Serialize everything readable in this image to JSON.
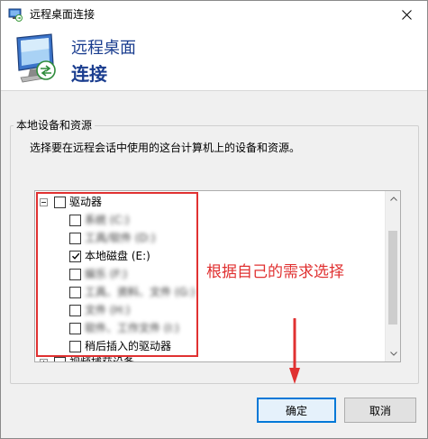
{
  "window": {
    "title": "远程桌面连接",
    "banner_line1": "远程桌面",
    "banner_line2": "连接"
  },
  "group": {
    "title": "本地设备和资源",
    "description": "选择要在远程会话中使用的这台计算机上的设备和资源。"
  },
  "tree": {
    "root_label": "驱动器",
    "items": [
      {
        "label": "系统 (C:)",
        "checked": false,
        "obscured": true
      },
      {
        "label": "工具/软件 (D:)",
        "checked": false,
        "obscured": true
      },
      {
        "label": "本地磁盘 (E:)",
        "checked": true,
        "obscured": false
      },
      {
        "label": "娱乐 (F:)",
        "checked": false,
        "obscured": true
      },
      {
        "label": "工具、资料、文件 (G:)",
        "checked": false,
        "obscured": true
      },
      {
        "label": "文件 (H:)",
        "checked": false,
        "obscured": true
      },
      {
        "label": "软件、工作文件 (I:)",
        "checked": false,
        "obscured": true
      },
      {
        "label": "稍后插入的驱动器",
        "checked": false,
        "obscured": false
      }
    ],
    "next_root_label": "视频捕获设备"
  },
  "annotation": "根据自己的需求选择",
  "buttons": {
    "ok": "确定",
    "cancel": "取消"
  },
  "colors": {
    "annotation_red": "#e03131",
    "banner_blue": "#1a3d8f",
    "focus_blue": "#0078d7"
  }
}
